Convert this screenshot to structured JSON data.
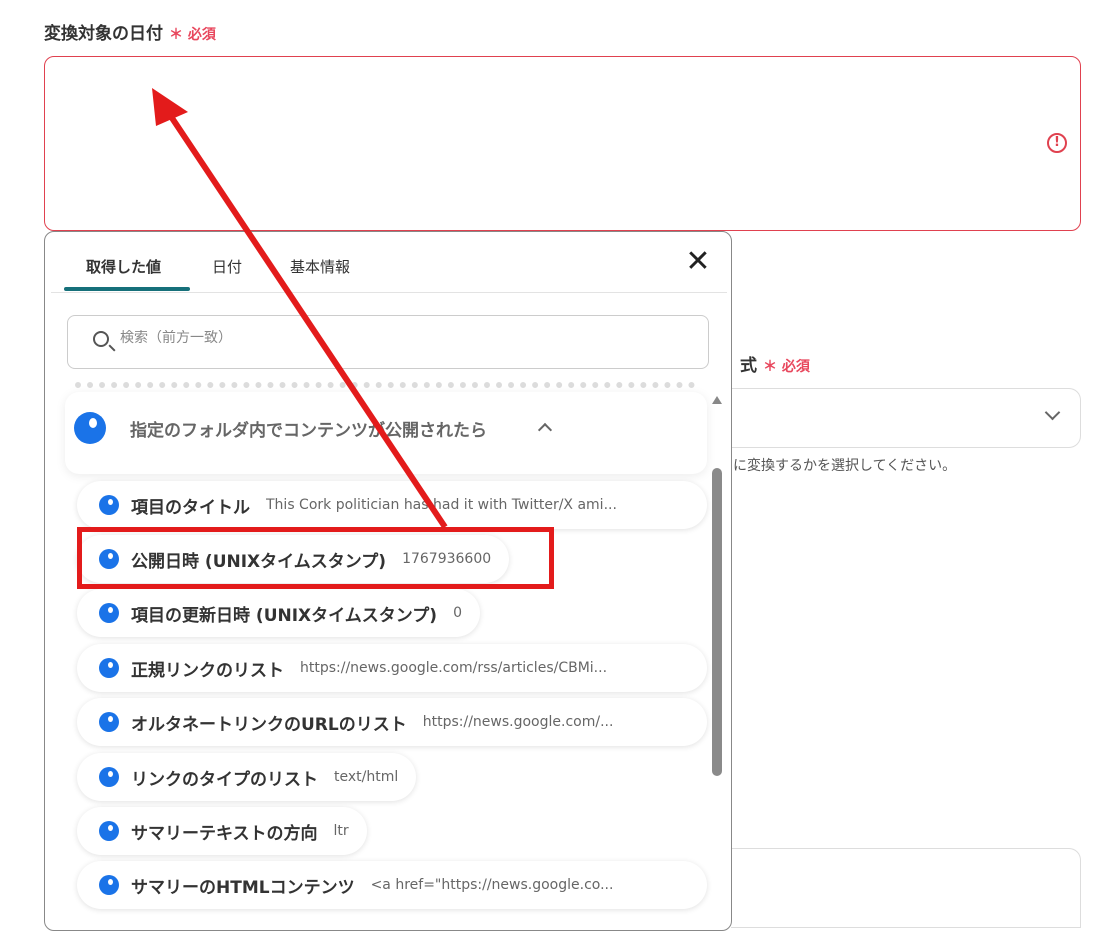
{
  "field": {
    "label": "変換対象の日付",
    "required": "＊ 必須",
    "error_icon": "!"
  },
  "field2": {
    "label": "式",
    "required": "＊ 必須",
    "help": "に変換するかを選択してください。"
  },
  "panel": {
    "tabs": [
      {
        "label": "取得した値"
      },
      {
        "label": "日付"
      },
      {
        "label": "基本情報"
      }
    ],
    "close": "✕",
    "search_placeholder": "検索（前方一致）",
    "group_title": "指定のフォルダ内でコンテンツが公開されたら",
    "items": [
      {
        "name": "項目のタイトル",
        "value": "This Cork politician has had it with Twitter/X ami..."
      },
      {
        "name": "公開日時 (UNIXタイムスタンプ)",
        "value": "1767936600"
      },
      {
        "name": "項目の更新日時 (UNIXタイムスタンプ)",
        "value": "0"
      },
      {
        "name": "正規リンクのリスト",
        "value": "https://news.google.com/rss/articles/CBMi..."
      },
      {
        "name": "オルタネートリンクのURLのリスト",
        "value": "https://news.google.com/..."
      },
      {
        "name": "リンクのタイプのリスト",
        "value": "text/html"
      },
      {
        "name": "サマリーテキストの方向",
        "value": "ltr"
      },
      {
        "name": "サマリーのHTMLコンテンツ",
        "value": "<a href=\"https://news.google.co..."
      }
    ]
  },
  "colors": {
    "accent": "#16707a",
    "error": "#e0414f",
    "dot": "#1a73e8",
    "annotation": "#e31b1b"
  }
}
